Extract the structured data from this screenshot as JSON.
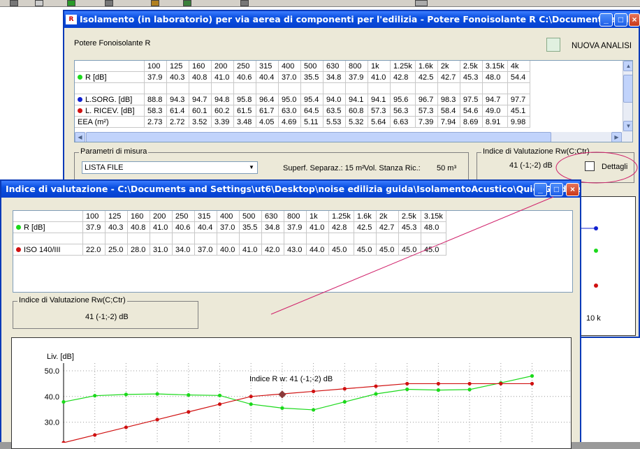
{
  "back_window": {
    "title": "Isolamento (in laboratorio) per via aerea di componenti per l'edilizia  - Potere Fonoisolante R   C:\\Documents and Se...",
    "section_label": "Potere Fonoisolante R",
    "new_analysis_label": "NUOVA ANALISI",
    "headers": [
      "100",
      "125",
      "160",
      "200",
      "250",
      "315",
      "400",
      "500",
      "630",
      "800",
      "1k",
      "1.25k",
      "1.6k",
      "2k",
      "2.5k",
      "3.15k",
      "4k"
    ],
    "rows": [
      {
        "label": "R [dB]",
        "color": "#1bd91b",
        "values": [
          "37.9",
          "40.3",
          "40.8",
          "41.0",
          "40.6",
          "40.4",
          "37.0",
          "35.5",
          "34.8",
          "37.9",
          "41.0",
          "42.8",
          "42.5",
          "42.7",
          "45.3",
          "48.0",
          "54.4"
        ]
      },
      {
        "label": "",
        "color": "",
        "values": [
          "",
          "",
          "",
          "",
          "",
          "",
          "",
          "",
          "",
          "",
          "",
          "",
          "",
          "",
          "",
          "",
          ""
        ]
      },
      {
        "label": "L.SORG. [dB]",
        "color": "#1020d0",
        "values": [
          "88.8",
          "94.3",
          "94.7",
          "94.8",
          "95.8",
          "96.4",
          "95.0",
          "95.4",
          "94.0",
          "94.1",
          "94.1",
          "95.6",
          "96.7",
          "98.3",
          "97.5",
          "94.7",
          "97.7"
        ]
      },
      {
        "label": "L. RICEV. [dB]",
        "color": "#d01010",
        "values": [
          "58.3",
          "61.4",
          "60.1",
          "60.2",
          "61.5",
          "61.7",
          "63.0",
          "64.5",
          "63.5",
          "60.8",
          "57.3",
          "56.3",
          "57.3",
          "58.4",
          "54.6",
          "49.0",
          "45.1"
        ]
      },
      {
        "label": "EEA (m²)",
        "color": "",
        "values": [
          "2.73",
          "2.72",
          "3.52",
          "3.39",
          "3.48",
          "4.05",
          "4.69",
          "5.11",
          "5.53",
          "5.32",
          "5.64",
          "6.63",
          "7.39",
          "7.94",
          "8.69",
          "8.91",
          "9.98"
        ]
      }
    ],
    "params_legend": "Parametri di misura",
    "select_value": "LISTA FILE",
    "superf_label": "Superf. Separaz.: 15 m²",
    "vol_label": "Vol. Stanza Ric.:",
    "vol_value": "50 m³",
    "index_legend": "Indice di Valutazione  Rw(C;Ctr)",
    "index_value": "41 (-1;-2) dB",
    "details_label": "Dettagli",
    "axis_right_label": "10 k"
  },
  "front_window": {
    "title": "Indice di valutazione - C:\\Documents and Settings\\ut6\\Desktop\\noise edilizia guida\\IsolamentoAcustico\\QuickGuide\\exa...",
    "headers": [
      "100",
      "125",
      "160",
      "200",
      "250",
      "315",
      "400",
      "500",
      "630",
      "800",
      "1k",
      "1.25k",
      "1.6k",
      "2k",
      "2.5k",
      "3.15k"
    ],
    "rows": [
      {
        "label": "R [dB]",
        "color": "#1bd91b",
        "values": [
          "37.9",
          "40.3",
          "40.8",
          "41.0",
          "40.6",
          "40.4",
          "37.0",
          "35.5",
          "34.8",
          "37.9",
          "41.0",
          "42.8",
          "42.5",
          "42.7",
          "45.3",
          "48.0"
        ]
      },
      {
        "label": "",
        "color": "",
        "values": [
          "",
          "",
          "",
          "",
          "",
          "",
          "",
          "",
          "",
          "",
          "",
          "",
          "",
          "",
          "",
          ""
        ]
      },
      {
        "label": "ISO 140/III",
        "color": "#d01010",
        "values": [
          "22.0",
          "25.0",
          "28.0",
          "31.0",
          "34.0",
          "37.0",
          "40.0",
          "41.0",
          "42.0",
          "43.0",
          "44.0",
          "45.0",
          "45.0",
          "45.0",
          "45.0",
          "45.0"
        ]
      }
    ],
    "index_legend": "Indice di Valutazione Rw(C;Ctr)",
    "index_value": "41 (-1;-2) dB"
  },
  "chart_data": {
    "type": "line",
    "ylabel": "Liv. [dB]",
    "y_ticks": [
      "50.0",
      "40.0",
      "30.0"
    ],
    "ylim": [
      22,
      53
    ],
    "annotation": "Indice  R  w: 41 (-1;-2) dB",
    "categories": [
      "100",
      "125",
      "160",
      "200",
      "250",
      "315",
      "400",
      "500",
      "630",
      "800",
      "1k",
      "1.25k",
      "1.6k",
      "2k",
      "2.5k",
      "3.15k"
    ],
    "series": [
      {
        "name": "R [dB]",
        "color": "#1bd91b",
        "values": [
          37.9,
          40.3,
          40.8,
          41.0,
          40.6,
          40.4,
          37.0,
          35.5,
          34.8,
          37.9,
          41.0,
          42.8,
          42.5,
          42.7,
          45.3,
          48.0
        ]
      },
      {
        "name": "ISO 140/III",
        "color": "#d01010",
        "values": [
          22.0,
          25.0,
          28.0,
          31.0,
          34.0,
          37.0,
          40.0,
          41.0,
          42.0,
          43.0,
          44.0,
          45.0,
          45.0,
          45.0,
          45.0,
          45.0
        ]
      }
    ],
    "marker_index": 6
  }
}
